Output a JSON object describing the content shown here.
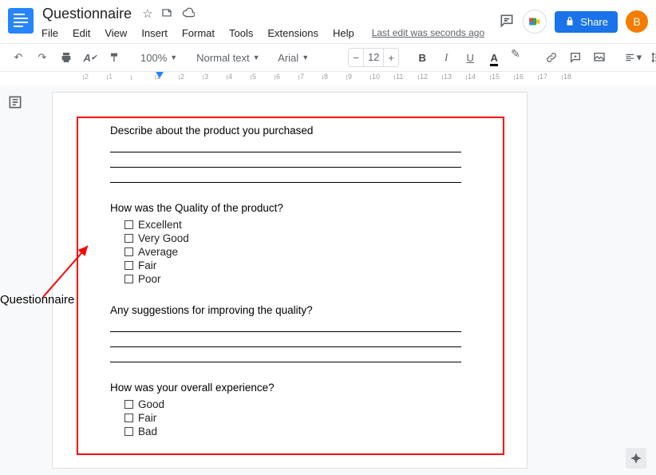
{
  "header": {
    "title": "Questionnaire",
    "edit_status": "Last edit was seconds ago",
    "menus": [
      "File",
      "Edit",
      "View",
      "Insert",
      "Format",
      "Tools",
      "Extensions",
      "Help"
    ],
    "share_label": "Share",
    "avatar_letter": "B"
  },
  "toolbar": {
    "zoom": "100%",
    "style": "Normal text",
    "font": "Arial",
    "font_size": "12"
  },
  "ruler": {
    "units": [
      "2",
      "1",
      "",
      "1",
      "2",
      "3",
      "4",
      "5",
      "6",
      "7",
      "8",
      "9",
      "10",
      "11",
      "12",
      "13",
      "14",
      "15",
      "16",
      "17",
      "18"
    ],
    "neg_count": 2
  },
  "annotation": {
    "label": "Questionnaire"
  },
  "doc": {
    "q1": "Describe about the product you purchased",
    "q2": "How was the Quality of the product?",
    "q2_options": [
      "Excellent",
      "Very Good",
      "Average",
      "Fair",
      "Poor"
    ],
    "q3": "Any suggestions for improving the quality?",
    "q4": "How was your overall experience?",
    "q4_options": [
      "Good",
      "Fair",
      "Bad"
    ]
  }
}
